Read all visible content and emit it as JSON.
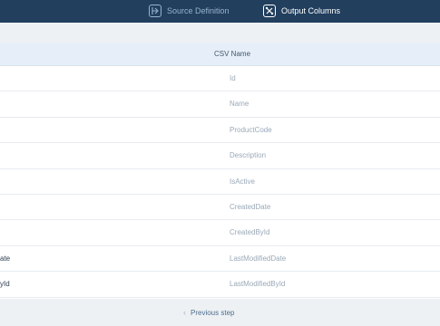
{
  "wizard": {
    "steps": [
      {
        "label": "Source Definition",
        "icon": "source-definition-icon",
        "active": false
      },
      {
        "label": "Output Columns",
        "icon": "output-columns-icon",
        "active": true
      }
    ]
  },
  "table": {
    "header": {
      "csv_name": "CSV Name"
    },
    "rows": [
      {
        "field": "",
        "csv": "Id"
      },
      {
        "field": "",
        "csv": "Name"
      },
      {
        "field": "",
        "csv": "ProductCode"
      },
      {
        "field": "",
        "csv": "Description"
      },
      {
        "field": "",
        "csv": "IsActive"
      },
      {
        "field": "",
        "csv": "CreatedDate"
      },
      {
        "field": "",
        "csv": "CreatedById"
      },
      {
        "field": "ate",
        "csv": "LastModifiedDate"
      },
      {
        "field": "yId",
        "csv": "LastModifiedById"
      }
    ]
  },
  "footer": {
    "previous_label": "Previous step",
    "previous_icon": "chevron-left-icon"
  },
  "colors": {
    "topbar": "#223f5e",
    "header_row": "#e6eff9",
    "page_bg": "#eef1f4"
  }
}
